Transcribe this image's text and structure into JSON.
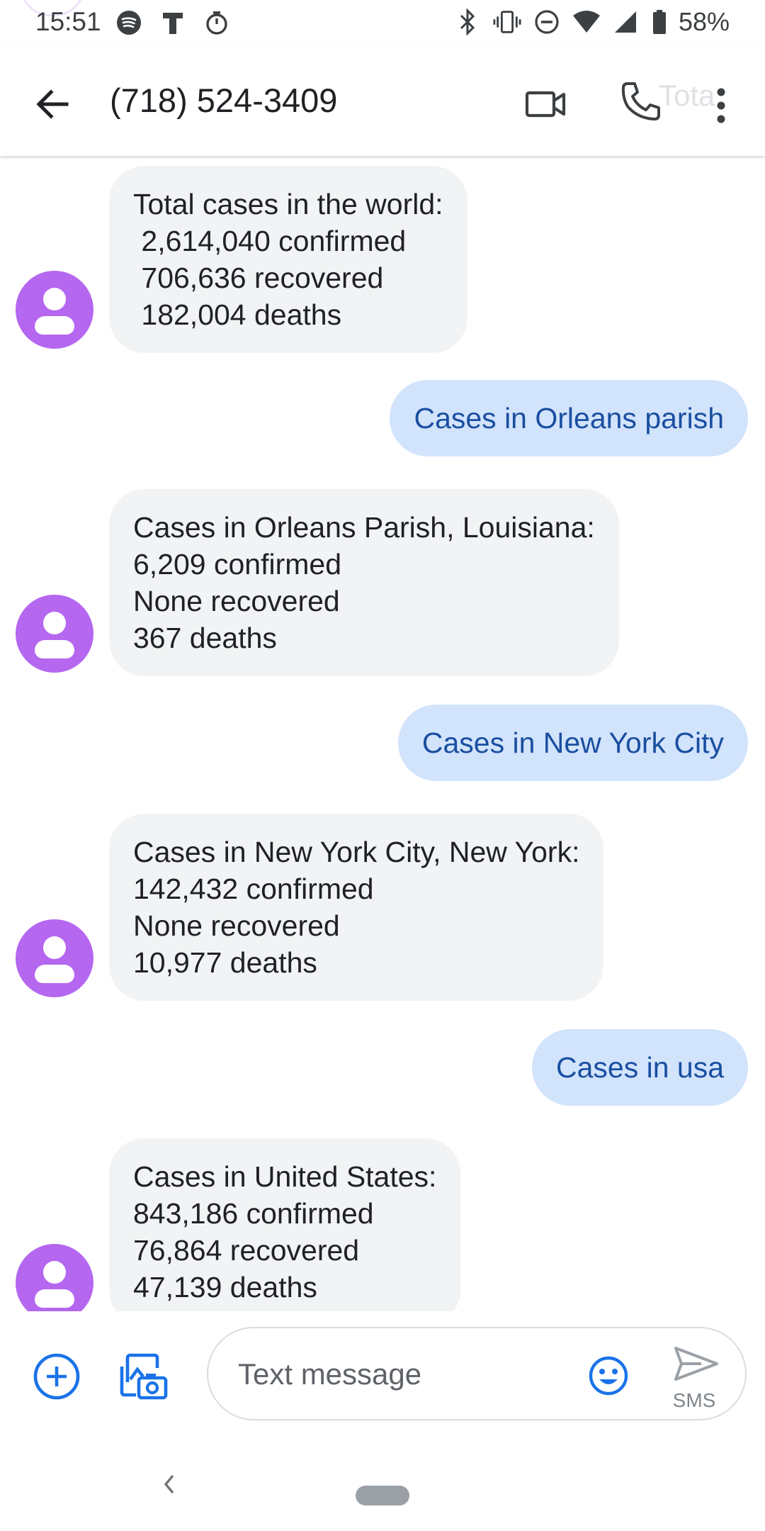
{
  "status_bar": {
    "time": "15:51",
    "battery": "58%",
    "icons": [
      "spotify-icon",
      "t-icon",
      "timer-icon",
      "bluetooth-icon",
      "vibrate-icon",
      "dnd-icon",
      "wifi-icon",
      "signal-icon",
      "battery-icon"
    ]
  },
  "app_bar": {
    "contact": "(718) 524-3409",
    "call_ghost_text": "Tota",
    "icons": [
      "back-arrow-icon",
      "video-call-icon",
      "phone-icon",
      "more-vert-icon"
    ]
  },
  "messages": [
    {
      "direction": "incoming",
      "text": "Total cases in the world:\n 2,614,040 confirmed\n 706,636 recovered\n 182,004 deaths"
    },
    {
      "direction": "outgoing",
      "text": "Cases in Orleans parish"
    },
    {
      "direction": "incoming",
      "text": "Cases in Orleans Parish, Louisiana:\n6,209 confirmed\nNone recovered\n367 deaths"
    },
    {
      "direction": "outgoing",
      "text": "Cases in New York City"
    },
    {
      "direction": "incoming",
      "text": "Cases in New York City, New York:\n142,432 confirmed\nNone recovered\n10,977 deaths"
    },
    {
      "direction": "outgoing",
      "text": "Cases in usa"
    },
    {
      "direction": "incoming",
      "text": "Cases in United States:\n843,186 confirmed\n76,864 recovered\n47,139 deaths"
    }
  ],
  "compose": {
    "placeholder": "Text message",
    "value": "",
    "send_label": "SMS"
  },
  "colors": {
    "accent": "#1a73e8",
    "avatar": "#b567f0",
    "incoming_bubble": "#f1f3f4",
    "outgoing_bubble": "#d2e3fc",
    "outgoing_text": "#1a4fa0"
  }
}
